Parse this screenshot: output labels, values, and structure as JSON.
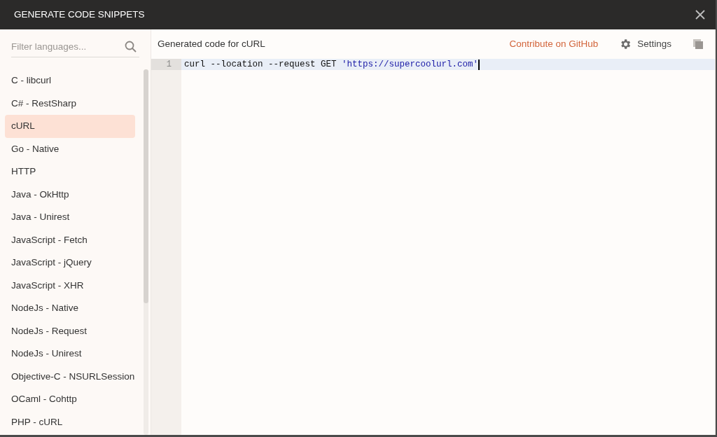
{
  "window": {
    "title": "GENERATE CODE SNIPPETS"
  },
  "search": {
    "placeholder": "Filter languages..."
  },
  "languages": [
    {
      "label": "C - libcurl",
      "selected": false
    },
    {
      "label": "C# - RestSharp",
      "selected": false
    },
    {
      "label": "cURL",
      "selected": true
    },
    {
      "label": "Go - Native",
      "selected": false
    },
    {
      "label": "HTTP",
      "selected": false
    },
    {
      "label": "Java - OkHttp",
      "selected": false
    },
    {
      "label": "Java - Unirest",
      "selected": false
    },
    {
      "label": "JavaScript - Fetch",
      "selected": false
    },
    {
      "label": "JavaScript - jQuery",
      "selected": false
    },
    {
      "label": "JavaScript - XHR",
      "selected": false
    },
    {
      "label": "NodeJs - Native",
      "selected": false
    },
    {
      "label": "NodeJs - Request",
      "selected": false
    },
    {
      "label": "NodeJs - Unirest",
      "selected": false
    },
    {
      "label": "Objective-C - NSURLSession",
      "selected": false
    },
    {
      "label": "OCaml - Cohttp",
      "selected": false
    },
    {
      "label": "PHP - cURL",
      "selected": false
    }
  ],
  "panel": {
    "heading": "Generated code for cURL",
    "contribute_link": "Contribute on GitHub",
    "settings_button": "Settings"
  },
  "code": {
    "lines": [
      {
        "number": "1",
        "tokens": [
          {
            "kind": "plain",
            "text": "curl --location --request GET "
          },
          {
            "kind": "string",
            "text": "'https://supercoolurl.com'"
          }
        ]
      }
    ]
  }
}
